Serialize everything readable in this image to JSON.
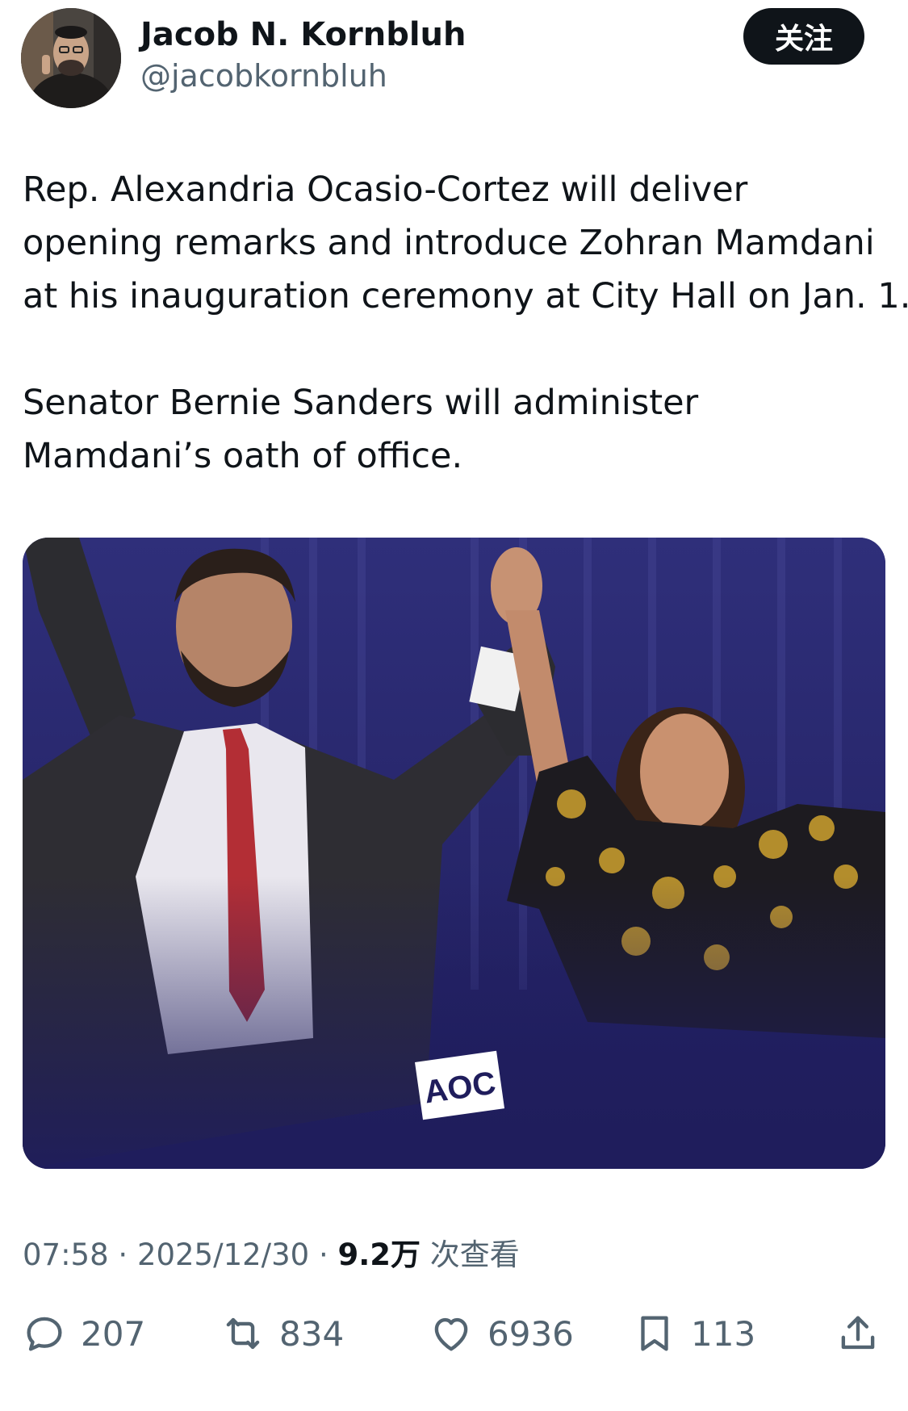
{
  "author": {
    "name": "Jacob N. Kornbluh",
    "handle": "@jacobkornbluh",
    "follow_label": "关注"
  },
  "tweet": {
    "paragraph1_lines": [
      "Rep. Alexandria Ocasio-Cortez will deliver",
      "opening remarks and introduce Zohran Mamdani",
      "at his inauguration ceremony at City Hall on Jan. 1."
    ],
    "paragraph2_lines": [
      "Senator Bernie Sanders will administer",
      "Mamdani’s oath of office."
    ]
  },
  "media": {
    "logo_text": "AOC"
  },
  "meta": {
    "time": "07:58",
    "sep1": " · ",
    "date": "2025/12/30",
    "sep2": " · ",
    "views_count": "9.2万",
    "views_label": " 次查看"
  },
  "actions": {
    "replies": "207",
    "reposts": "834",
    "likes": "6936",
    "bookmarks": "113"
  },
  "colors": {
    "text_primary": "#0f1419",
    "text_secondary": "#536471",
    "follow_bg": "#0f1419",
    "media_bg": "#2b2a6e"
  },
  "icons": {
    "reply": "speech-bubble-icon",
    "repost": "repost-arrows-icon",
    "like": "heart-icon",
    "bookmark": "bookmark-icon",
    "share": "share-upload-icon"
  }
}
